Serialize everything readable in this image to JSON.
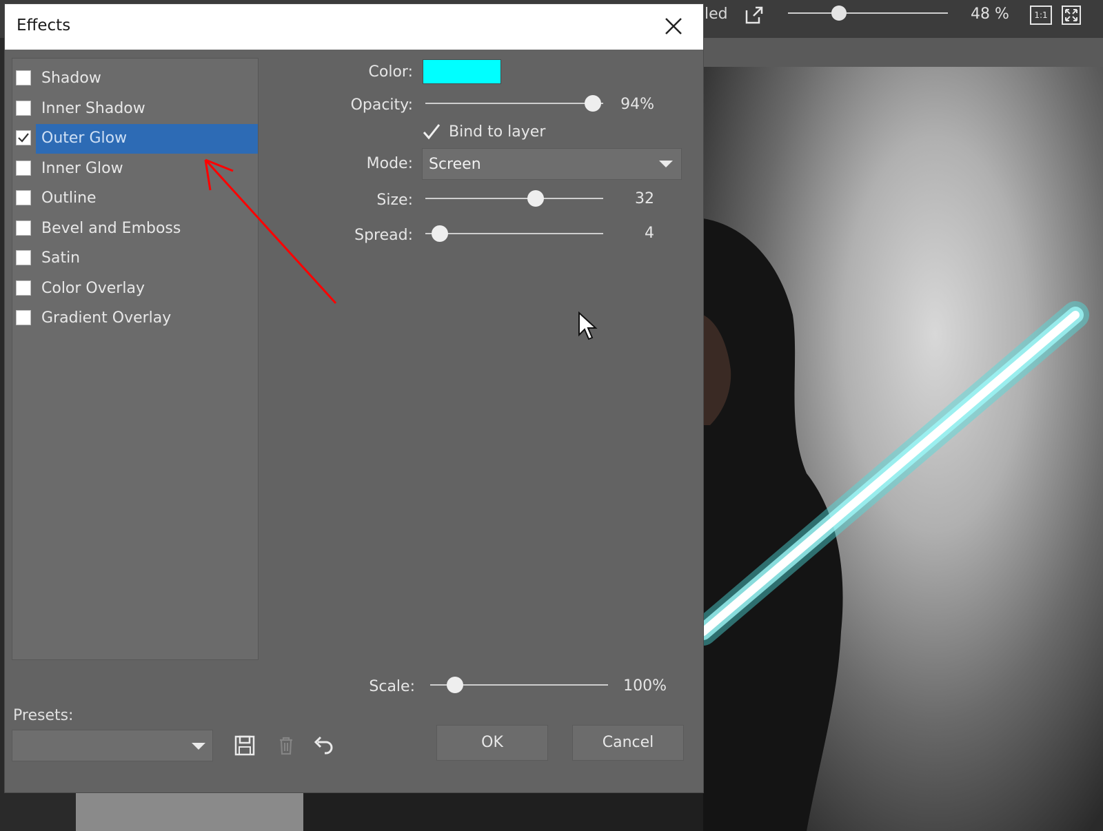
{
  "background_app": {
    "title_fragment": "led",
    "zoom_label": "48 %",
    "zoom_level": 0.32,
    "one_to_one_label": "1:1"
  },
  "dialog": {
    "title": "Effects",
    "effects": [
      {
        "label": "Shadow",
        "checked": false,
        "selected": false
      },
      {
        "label": "Inner Shadow",
        "checked": false,
        "selected": false
      },
      {
        "label": "Outer Glow",
        "checked": true,
        "selected": true
      },
      {
        "label": "Inner Glow",
        "checked": false,
        "selected": false
      },
      {
        "label": "Outline",
        "checked": false,
        "selected": false
      },
      {
        "label": "Bevel and Emboss",
        "checked": false,
        "selected": false
      },
      {
        "label": "Satin",
        "checked": false,
        "selected": false
      },
      {
        "label": "Color Overlay",
        "checked": false,
        "selected": false
      },
      {
        "label": "Gradient Overlay",
        "checked": false,
        "selected": false
      }
    ],
    "properties": {
      "color_label": "Color:",
      "color_value": "#00FFFF",
      "opacity_label": "Opacity:",
      "opacity_value": "94%",
      "opacity_fraction": 0.94,
      "bind_label": "Bind to layer",
      "bind_checked": true,
      "mode_label": "Mode:",
      "mode_value": "Screen",
      "size_label": "Size:",
      "size_value": "32",
      "size_fraction": 0.62,
      "spread_label": "Spread:",
      "spread_value": "4",
      "spread_fraction": 0.08,
      "scale_label": "Scale:",
      "scale_value": "100%",
      "scale_fraction": 0.14
    },
    "presets_label": "Presets:",
    "ok_label": "OK",
    "cancel_label": "Cancel"
  },
  "colors": {
    "accent": "#2d6bb5",
    "annotation": "#ff0000",
    "glow": "#7ff5f5"
  },
  "icons": [
    "close-icon",
    "external-link-icon",
    "fit-screen-icon",
    "save-icon",
    "trash-icon",
    "undo-icon",
    "mouse-cursor-icon"
  ]
}
